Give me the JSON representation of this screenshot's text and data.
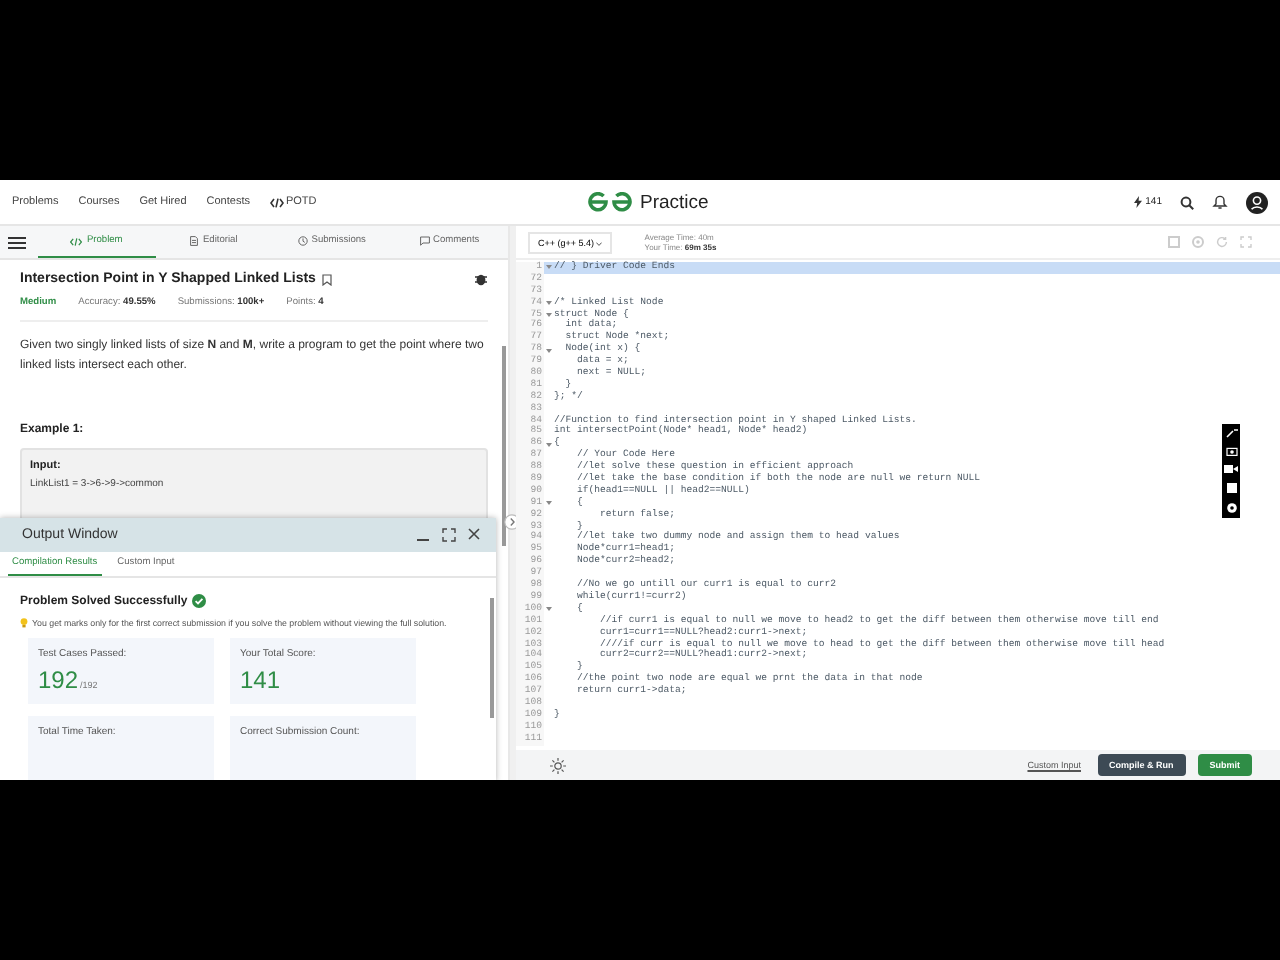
{
  "nav": {
    "links": [
      {
        "label": "Problems"
      },
      {
        "label": "Courses"
      },
      {
        "label": "Get Hired"
      },
      {
        "label": "Contests"
      },
      {
        "label": "POTD"
      }
    ],
    "logo_text": "Practice",
    "streak": "141"
  },
  "problem_tabs": [
    {
      "label": "Problem",
      "selected": true
    },
    {
      "label": "Editorial",
      "selected": false
    },
    {
      "label": "Submissions",
      "selected": false
    },
    {
      "label": "Comments",
      "selected": false
    }
  ],
  "problem": {
    "title": "Intersection Point in Y Shapped Linked Lists",
    "difficulty": "Medium",
    "accuracy_label": "Accuracy:",
    "accuracy": "49.55%",
    "submissions_label": "Submissions:",
    "submissions": "100k+",
    "points_label": "Points:",
    "points": "4",
    "description": "Given two singly linked lists of size **N** and **M**, write a program to get the point where two linked lists intersect each other.",
    "example_title": "Example 1:",
    "input_label": "Input:",
    "input_line": "LinkList1 = 3->6->9->common"
  },
  "output_window": {
    "title": "Output Window",
    "tabs": [
      {
        "label": "Compilation Results",
        "selected": true
      },
      {
        "label": "Custom Input",
        "selected": false
      }
    ],
    "status": "Problem Solved Successfully",
    "tip": "You get marks only for the first correct submission if you solve the problem without viewing the full solution.",
    "cards": [
      {
        "label": "Test Cases Passed:",
        "value": "192",
        "total": "/192"
      },
      {
        "label": "Your Total Score:",
        "value": "141"
      },
      {
        "label": "Total Time Taken:"
      },
      {
        "label": "Correct Submission Count:"
      }
    ]
  },
  "editor": {
    "language": "C++ (g++ 5.4)",
    "average_time": "Average Time: 40m",
    "your_time_label": "Your Time:",
    "your_time": "69m 35s",
    "lines": [
      {
        "n": "1",
        "code": "// } Driver Code Ends",
        "fold": true,
        "selected": true
      },
      {
        "n": "72",
        "fold": false,
        "selected": false
      },
      {
        "n": "73",
        "fold": false,
        "selected": false
      },
      {
        "n": "74",
        "code": "/* Linked List Node",
        "fold": true,
        "selected": false
      },
      {
        "n": "75",
        "code": "struct Node {",
        "fold": true,
        "selected": false
      },
      {
        "n": "76",
        "code": "  int data;",
        "fold": false,
        "selected": false
      },
      {
        "n": "77",
        "code": "  struct Node *next;",
        "fold": false,
        "selected": false
      },
      {
        "n": "78",
        "code": "  Node(int x) {",
        "fold": true,
        "selected": false
      },
      {
        "n": "79",
        "code": "    data = x;",
        "fold": false,
        "selected": false
      },
      {
        "n": "80",
        "code": "    next = NULL;",
        "fold": false,
        "selected": false
      },
      {
        "n": "81",
        "code": "  }",
        "fold": false,
        "selected": false
      },
      {
        "n": "82",
        "code": "}; */",
        "fold": false,
        "selected": false
      },
      {
        "n": "83",
        "fold": false,
        "selected": false
      },
      {
        "n": "84",
        "code": "//Function to find intersection point in Y shaped Linked Lists.",
        "fold": false,
        "selected": false
      },
      {
        "n": "85",
        "code": "int intersectPoint(Node* head1, Node* head2)",
        "fold": false,
        "selected": false
      },
      {
        "n": "86",
        "code": "{",
        "fold": true,
        "selected": false
      },
      {
        "n": "87",
        "code": "    // Your Code Here",
        "fold": false,
        "selected": false
      },
      {
        "n": "88",
        "code": "    //let solve these question in efficient approach",
        "fold": false,
        "selected": false
      },
      {
        "n": "89",
        "code": "    //let take the base condition if both the node are null we return NULL",
        "fold": false,
        "selected": false
      },
      {
        "n": "90",
        "code": "    if(head1==NULL || head2==NULL)",
        "fold": false,
        "selected": false
      },
      {
        "n": "91",
        "code": "    {",
        "fold": true,
        "selected": false
      },
      {
        "n": "92",
        "code": "        return false;",
        "fold": false,
        "selected": false
      },
      {
        "n": "93",
        "code": "    }",
        "fold": false,
        "selected": false
      },
      {
        "n": "94",
        "code": "    //let take two dummy node and assign them to head values",
        "fold": false,
        "selected": false
      },
      {
        "n": "95",
        "code": "    Node*curr1=head1;",
        "fold": false,
        "selected": false
      },
      {
        "n": "96",
        "code": "    Node*curr2=head2;",
        "fold": false,
        "selected": false
      },
      {
        "n": "97",
        "fold": false,
        "selected": false
      },
      {
        "n": "98",
        "code": "    //No we go untill our curr1 is equal to curr2",
        "fold": false,
        "selected": false
      },
      {
        "n": "99",
        "code": "    while(curr1!=curr2)",
        "fold": false,
        "selected": false
      },
      {
        "n": "100",
        "code": "    {",
        "fold": true,
        "selected": false
      },
      {
        "n": "101",
        "code": "        //if curr1 is equal to null we move to head2 to get the diff between them otherwise move till end",
        "fold": false,
        "selected": false
      },
      {
        "n": "102",
        "code": "        curr1=curr1==NULL?head2:curr1->next;",
        "fold": false,
        "selected": false
      },
      {
        "n": "103",
        "code": "        ////if curr is equal to null we move to head to get the diff between them otherwise move till head",
        "fold": false,
        "selected": false
      },
      {
        "n": "104",
        "code": "        curr2=curr2==NULL?head1:curr2->next;",
        "fold": false,
        "selected": false
      },
      {
        "n": "105",
        "code": "    }",
        "fold": false,
        "selected": false
      },
      {
        "n": "106",
        "code": "    //the point two node are equal we prnt the data in that node",
        "fold": false,
        "selected": false
      },
      {
        "n": "107",
        "code": "    return curr1->data;",
        "fold": false,
        "selected": false
      },
      {
        "n": "108",
        "fold": false,
        "selected": false
      },
      {
        "n": "109",
        "code": "}",
        "fold": false,
        "selected": false
      },
      {
        "n": "110",
        "fold": false,
        "selected": false
      },
      {
        "n": "111",
        "fold": false,
        "selected": false
      }
    ],
    "custom_input": "Custom Input",
    "compile": "Compile & Run",
    "submit": "Submit"
  }
}
